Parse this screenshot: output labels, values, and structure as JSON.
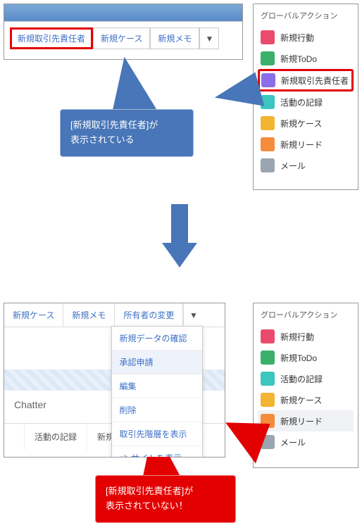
{
  "topBar": {
    "buttons": [
      "新規取引先責任者",
      "新規ケース",
      "新規メモ"
    ]
  },
  "globalPanelTitle": "グローバルアクション",
  "globalTop": [
    {
      "label": "新規行動",
      "color": "#ea4b6c"
    },
    {
      "label": "新規ToDo",
      "color": "#3bb06b"
    },
    {
      "label": "新規取引先責任者",
      "color": "#8c6fe8",
      "boxed": true
    },
    {
      "label": "活動の記録",
      "color": "#3bc7c0"
    },
    {
      "label": "新規ケース",
      "color": "#f2b431"
    },
    {
      "label": "新規リード",
      "color": "#f58b3c"
    },
    {
      "label": "メール",
      "color": "#9aa5b1"
    }
  ],
  "calloutBlue": {
    "line1": "[新規取引先責任者]が",
    "line2": "表示されている"
  },
  "bottomBar": {
    "buttons": [
      "新規ケース",
      "新規メモ",
      "所有者の変更"
    ]
  },
  "ddMenu": [
    "新規データの確認",
    "承認申請",
    "編集",
    "削除",
    "取引先階層を表示",
    "eb サイトを表示"
  ],
  "chatter": "Chatter",
  "tabs": [
    "",
    "活動の記録",
    "新規行動"
  ],
  "globalBottom": [
    {
      "label": "新規行動",
      "color": "#ea4b6c"
    },
    {
      "label": "新規ToDo",
      "color": "#3bb06b"
    },
    {
      "label": "活動の記録",
      "color": "#3bc7c0"
    },
    {
      "label": "新規ケース",
      "color": "#f2b431"
    },
    {
      "label": "新規リード",
      "color": "#f58b3c",
      "shaded": true
    },
    {
      "label": "メール",
      "color": "#9aa5b1"
    }
  ],
  "calloutRed": {
    "line1": "[新規取引先責任者]が",
    "line2": "表示されていない！"
  }
}
